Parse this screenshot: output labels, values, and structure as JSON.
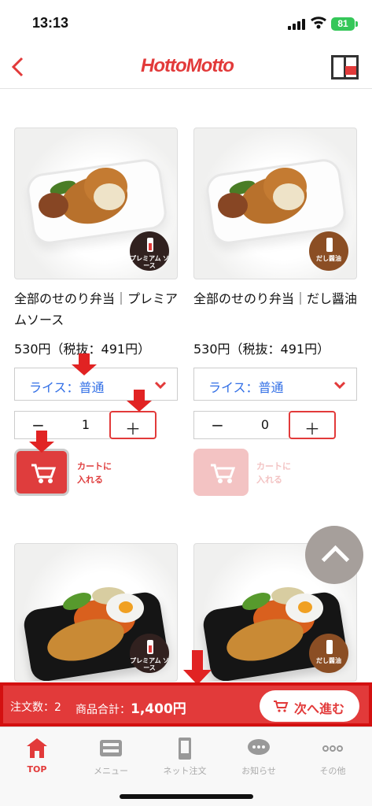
{
  "status_bar": {
    "time": "13:13",
    "battery": "81"
  },
  "header": {
    "logo": "HottoMotto"
  },
  "products": [
    {
      "name": "全部のせのり弁当｜プレミアムソース",
      "price": "530円（税抜：491円）",
      "rice": "ライス：普通",
      "quantity": "1",
      "badge": "プレミアム\nソース",
      "cart": "カートに\n入れる",
      "cart_enabled": true
    },
    {
      "name": "全部のせのり弁当｜だし醤油",
      "price": "530円（税抜：491円）",
      "rice": "ライス：普通",
      "quantity": "0",
      "badge": "だし醤油",
      "cart": "カートに\n入れる",
      "cart_enabled": false
    },
    {
      "badge": "プレミアム\nソース"
    },
    {
      "badge": "だし醤油"
    }
  ],
  "controls": {
    "minus": "−",
    "plus": "＋"
  },
  "order": {
    "count": "注文数：2",
    "total_label": "商品合計：",
    "total": "1,400円",
    "next": "次へ進む"
  },
  "tabs": [
    "TOP",
    "メニュー",
    "ネット注文",
    "お知らせ",
    "その他"
  ],
  "colors": {
    "brand": "#e23a3a",
    "link": "#326fe6",
    "active_tab": "#e23a3a"
  },
  "icons": {
    "back": "chevron-left-icon",
    "cart": "shopping-cart-icon",
    "scroll": "chevron-up-icon"
  }
}
